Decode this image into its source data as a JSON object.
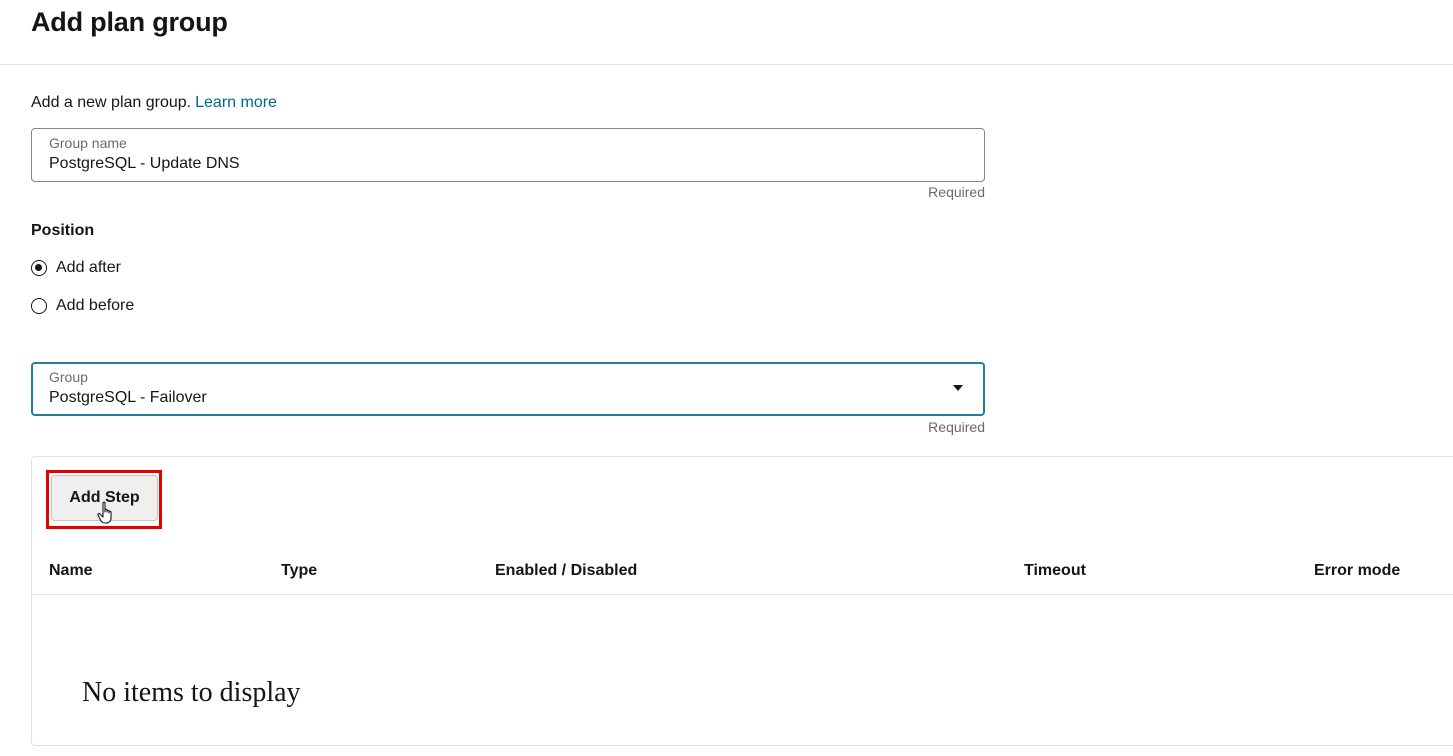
{
  "header": {
    "title": "Add plan group"
  },
  "intro": {
    "text": "Add a new plan group.",
    "link": "Learn more"
  },
  "group_name_field": {
    "label": "Group name",
    "value": "PostgreSQL - Update DNS",
    "hint": "Required"
  },
  "position": {
    "label": "Position",
    "options": [
      {
        "label": "Add after",
        "checked": true
      },
      {
        "label": "Add before",
        "checked": false
      }
    ]
  },
  "group_select": {
    "label": "Group",
    "value": "PostgreSQL - Failover",
    "hint": "Required"
  },
  "steps": {
    "add_button": "Add Step",
    "columns": [
      "Name",
      "Type",
      "Enabled / Disabled",
      "Timeout",
      "Error mode"
    ],
    "empty_text": "No items to display"
  },
  "colors": {
    "link": "#00688c",
    "focus_border": "#227e9e",
    "highlight": "#e00000"
  }
}
